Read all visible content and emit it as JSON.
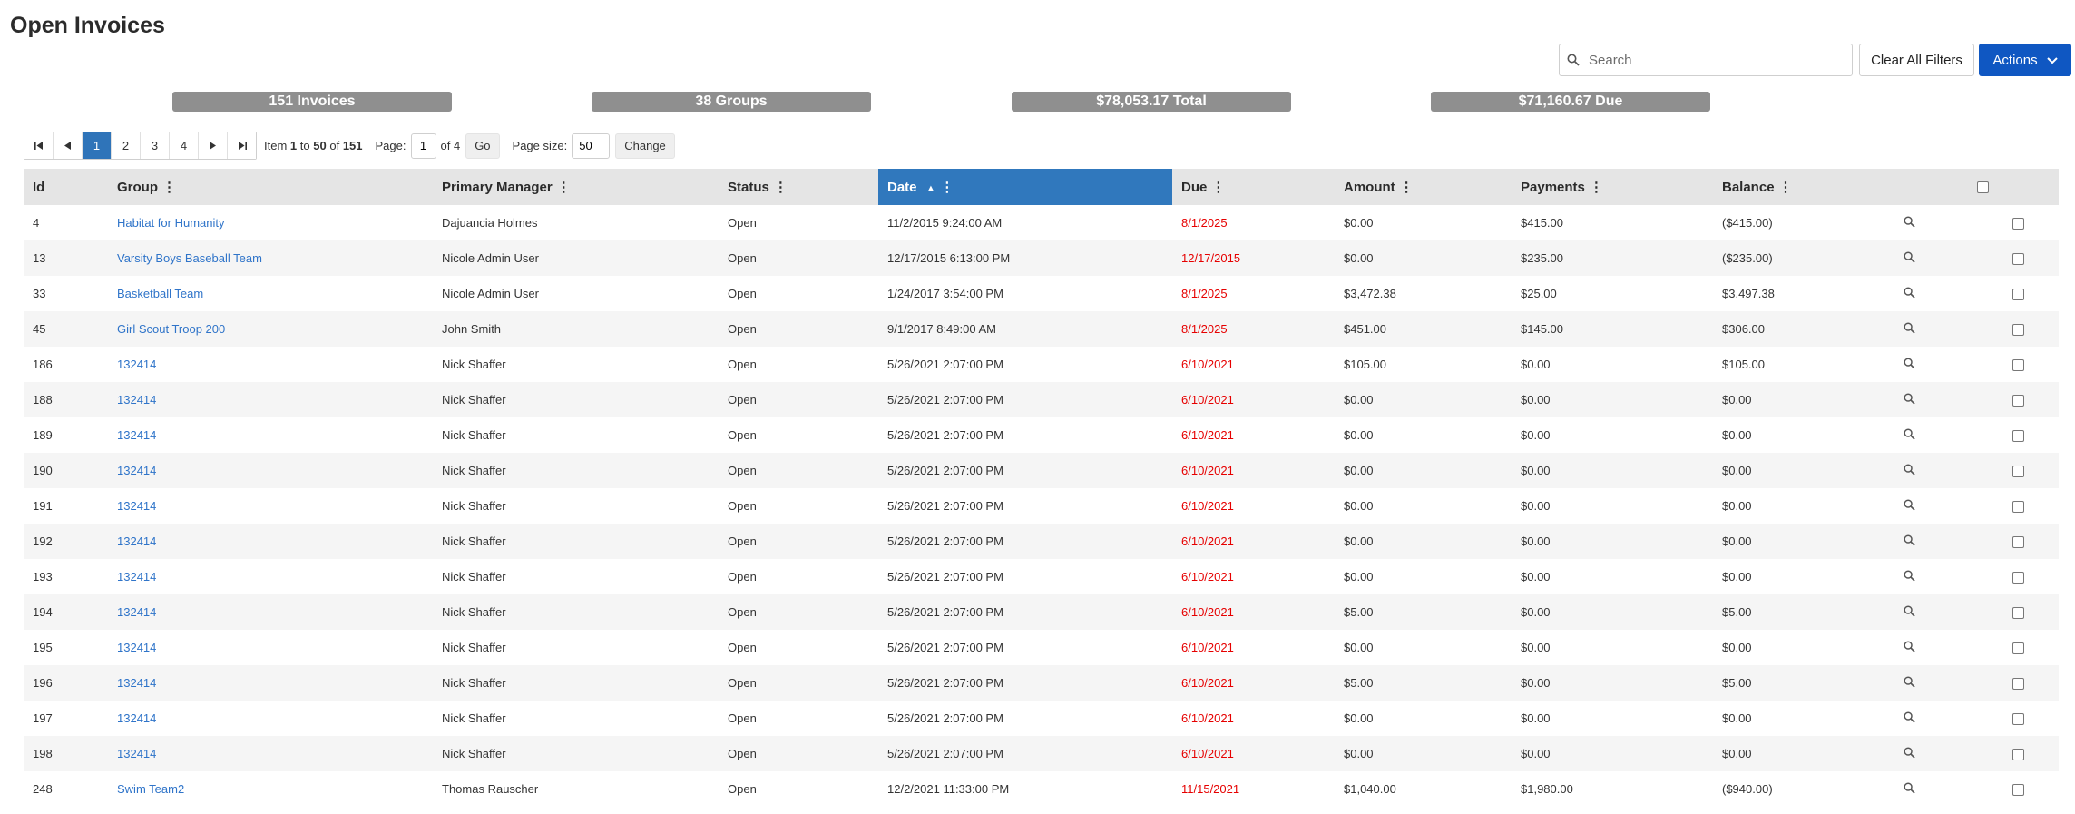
{
  "page": {
    "title": "Open Invoices"
  },
  "toolbar": {
    "search_placeholder": "Search",
    "clear_filters_label": "Clear All Filters",
    "actions_label": "Actions"
  },
  "summary": {
    "invoices": "151 Invoices",
    "groups": "38 Groups",
    "total": "$78,053.17 Total",
    "due": "$71,160.67 Due"
  },
  "pager": {
    "first": "⏮",
    "prev": "◀",
    "next": "▶",
    "last": "⏭",
    "pages": [
      "1",
      "2",
      "3",
      "4"
    ],
    "active_page": "1",
    "item_prefix": "Item",
    "range_start": "1",
    "range_to": "to",
    "range_end": "50",
    "of_word": "of",
    "total_items": "151",
    "page_label": "Page:",
    "page_value": "1",
    "page_of": "of 4",
    "go_label": "Go",
    "size_label": "Page size:",
    "size_value": "50",
    "change_label": "Change"
  },
  "table": {
    "columns": [
      "Id",
      "Group",
      "Primary Manager",
      "Status",
      "Date",
      "Due",
      "Amount",
      "Payments",
      "Balance"
    ],
    "sorted_column": "Date",
    "sort_direction": "ascending",
    "rows": [
      {
        "id": "4",
        "group": "Habitat for Humanity",
        "manager": "Dajuancia Holmes",
        "status": "Open",
        "date": "11/2/2015 9:24:00 AM",
        "due": "8/1/2025",
        "amount": "$0.00",
        "payments": "$415.00",
        "balance": "($415.00)"
      },
      {
        "id": "13",
        "group": "Varsity Boys Baseball Team",
        "manager": "Nicole Admin User",
        "status": "Open",
        "date": "12/17/2015 6:13:00 PM",
        "due": "12/17/2015",
        "amount": "$0.00",
        "payments": "$235.00",
        "balance": "($235.00)"
      },
      {
        "id": "33",
        "group": "Basketball Team",
        "manager": "Nicole Admin User",
        "status": "Open",
        "date": "1/24/2017 3:54:00 PM",
        "due": "8/1/2025",
        "amount": "$3,472.38",
        "payments": "$25.00",
        "balance": "$3,497.38"
      },
      {
        "id": "45",
        "group": "Girl Scout Troop 200",
        "manager": "John Smith",
        "status": "Open",
        "date": "9/1/2017 8:49:00 AM",
        "due": "8/1/2025",
        "amount": "$451.00",
        "payments": "$145.00",
        "balance": "$306.00"
      },
      {
        "id": "186",
        "group": "132414",
        "manager": "Nick Shaffer",
        "status": "Open",
        "date": "5/26/2021 2:07:00 PM",
        "due": "6/10/2021",
        "amount": "$105.00",
        "payments": "$0.00",
        "balance": "$105.00"
      },
      {
        "id": "188",
        "group": "132414",
        "manager": "Nick Shaffer",
        "status": "Open",
        "date": "5/26/2021 2:07:00 PM",
        "due": "6/10/2021",
        "amount": "$0.00",
        "payments": "$0.00",
        "balance": "$0.00"
      },
      {
        "id": "189",
        "group": "132414",
        "manager": "Nick Shaffer",
        "status": "Open",
        "date": "5/26/2021 2:07:00 PM",
        "due": "6/10/2021",
        "amount": "$0.00",
        "payments": "$0.00",
        "balance": "$0.00"
      },
      {
        "id": "190",
        "group": "132414",
        "manager": "Nick Shaffer",
        "status": "Open",
        "date": "5/26/2021 2:07:00 PM",
        "due": "6/10/2021",
        "amount": "$0.00",
        "payments": "$0.00",
        "balance": "$0.00"
      },
      {
        "id": "191",
        "group": "132414",
        "manager": "Nick Shaffer",
        "status": "Open",
        "date": "5/26/2021 2:07:00 PM",
        "due": "6/10/2021",
        "amount": "$0.00",
        "payments": "$0.00",
        "balance": "$0.00"
      },
      {
        "id": "192",
        "group": "132414",
        "manager": "Nick Shaffer",
        "status": "Open",
        "date": "5/26/2021 2:07:00 PM",
        "due": "6/10/2021",
        "amount": "$0.00",
        "payments": "$0.00",
        "balance": "$0.00"
      },
      {
        "id": "193",
        "group": "132414",
        "manager": "Nick Shaffer",
        "status": "Open",
        "date": "5/26/2021 2:07:00 PM",
        "due": "6/10/2021",
        "amount": "$0.00",
        "payments": "$0.00",
        "balance": "$0.00"
      },
      {
        "id": "194",
        "group": "132414",
        "manager": "Nick Shaffer",
        "status": "Open",
        "date": "5/26/2021 2:07:00 PM",
        "due": "6/10/2021",
        "amount": "$5.00",
        "payments": "$0.00",
        "balance": "$5.00"
      },
      {
        "id": "195",
        "group": "132414",
        "manager": "Nick Shaffer",
        "status": "Open",
        "date": "5/26/2021 2:07:00 PM",
        "due": "6/10/2021",
        "amount": "$0.00",
        "payments": "$0.00",
        "balance": "$0.00"
      },
      {
        "id": "196",
        "group": "132414",
        "manager": "Nick Shaffer",
        "status": "Open",
        "date": "5/26/2021 2:07:00 PM",
        "due": "6/10/2021",
        "amount": "$5.00",
        "payments": "$0.00",
        "balance": "$5.00"
      },
      {
        "id": "197",
        "group": "132414",
        "manager": "Nick Shaffer",
        "status": "Open",
        "date": "5/26/2021 2:07:00 PM",
        "due": "6/10/2021",
        "amount": "$0.00",
        "payments": "$0.00",
        "balance": "$0.00"
      },
      {
        "id": "198",
        "group": "132414",
        "manager": "Nick Shaffer",
        "status": "Open",
        "date": "5/26/2021 2:07:00 PM",
        "due": "6/10/2021",
        "amount": "$0.00",
        "payments": "$0.00",
        "balance": "$0.00"
      },
      {
        "id": "248",
        "group": "Swim Team2",
        "manager": "Thomas Rauscher",
        "status": "Open",
        "date": "12/2/2021 11:33:00 PM",
        "due": "11/15/2021",
        "amount": "$1,040.00",
        "payments": "$1,980.00",
        "balance": "($940.00)"
      }
    ]
  },
  "icons": {
    "search": "search-icon",
    "actions_chevron": "chevron-down-icon",
    "column_menu": "kebab-menu-icon",
    "sort": "sort-ascending-icon",
    "row_view": "magnifier-icon"
  },
  "colors": {
    "accent": "#0f57c2",
    "sorted_header": "#3078bd",
    "active_page": "#2f74b9",
    "link": "#2f74c9",
    "due": "#e60000",
    "summary_pill": "#8f8f8f"
  }
}
